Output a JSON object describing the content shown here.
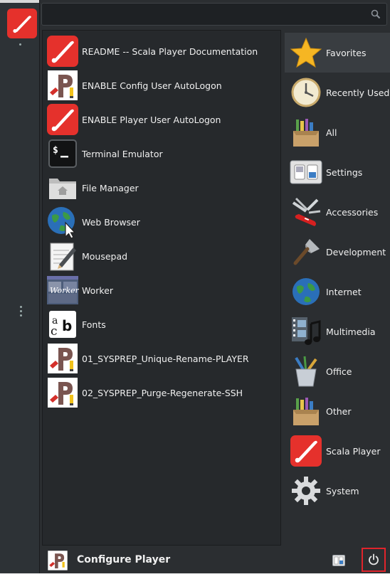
{
  "search": {
    "value": "",
    "placeholder": ""
  },
  "apps": [
    {
      "label": "README -- Scala Player Documentation",
      "icon": "scala-player-icon"
    },
    {
      "label": "ENABLE Config User AutoLogon",
      "icon": "script-p-icon"
    },
    {
      "label": "ENABLE Player User AutoLogon",
      "icon": "scala-player-icon"
    },
    {
      "label": "Terminal Emulator",
      "icon": "terminal-icon"
    },
    {
      "label": "File Manager",
      "icon": "folder-home-icon"
    },
    {
      "label": "Web Browser",
      "icon": "globe-cursor-icon"
    },
    {
      "label": "Mousepad",
      "icon": "notepad-icon"
    },
    {
      "label": "Worker",
      "icon": "worker-icon"
    },
    {
      "label": "Fonts",
      "icon": "fonts-icon"
    },
    {
      "label": "01_SYSPREP_Unique-Rename-PLAYER",
      "icon": "script-p-icon"
    },
    {
      "label": "02_SYSPREP_Purge-Regenerate-SSH",
      "icon": "script-p-icon"
    }
  ],
  "categories": [
    {
      "label": "Favorites",
      "icon": "star-icon",
      "active": true
    },
    {
      "label": "Recently Used",
      "icon": "clock-icon"
    },
    {
      "label": "All",
      "icon": "box-tools-icon"
    },
    {
      "label": "Settings",
      "icon": "toggle-switches-icon"
    },
    {
      "label": "Accessories",
      "icon": "swiss-knife-icon"
    },
    {
      "label": "Development",
      "icon": "trowel-icon"
    },
    {
      "label": "Internet",
      "icon": "globe-icon"
    },
    {
      "label": "Multimedia",
      "icon": "film-music-icon"
    },
    {
      "label": "Office",
      "icon": "pencil-cup-icon"
    },
    {
      "label": "Other",
      "icon": "box-tools-icon"
    },
    {
      "label": "Scala Player",
      "icon": "scala-player-icon"
    },
    {
      "label": "System",
      "icon": "gear-icon"
    }
  ],
  "footer": {
    "user_name": "Configure Player"
  },
  "colors": {
    "accent_red": "#e5312c",
    "highlight_border": "#e0242b"
  }
}
